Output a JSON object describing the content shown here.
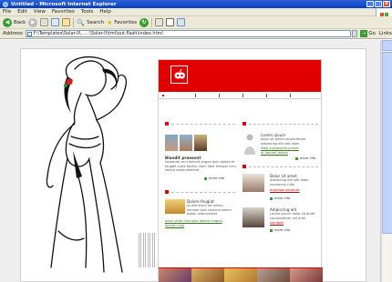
{
  "window": {
    "title": "Untitled - Microsoft Internet Explorer",
    "buttons": [
      "_",
      "□",
      "x"
    ]
  },
  "menu": [
    "File",
    "Edit",
    "View",
    "Favorites",
    "Tools",
    "Help"
  ],
  "toolbar": {
    "back_label": "Back",
    "search_label": "Search",
    "favorites_label": "Favorites"
  },
  "address": {
    "label": "Address",
    "value": "F:\\Templates\\Solar-II\\......\\Solar-II\\tmi\\out.flash\\index.html",
    "go_label": "Go",
    "links_label": "Links"
  },
  "site": {
    "sections": {
      "top_left": {
        "title": "Blandit praesent",
        "body": "luptatum zzril delenit augue duis dolore te feugait nulla facilisi. Nam liber tempor cum soluta nobis eleifend",
        "more": "more info"
      },
      "top_right": {
        "title": "Lorem ipsum",
        "body": "dolor sit amet consectetuer adipiscing elit sed diam",
        "links": [
          "Nibh euismod tincidunt",
          "ut laoreet dolore"
        ],
        "more": "more info"
      },
      "mid_left": {
        "title": "Dolore feugiat",
        "body": "ut wisi enim ad minim veniam quis nostrud exerci tation ullamcorper",
        "links": [
          "dolor vitae duis odio dolore magna",
          "dolore nulla"
        ]
      },
      "mid_right_1": {
        "title": "Dolor sit amet",
        "body": "adipiscing elit sed diam nonummy nibh",
        "links": [
          "euismod tincidunt"
        ],
        "more": "more info"
      },
      "mid_right_2": {
        "title": "Adipiscing elit",
        "body": "Lorem ipsum dolor sit amet consectetuer vel eum",
        "links": [
          "volutpat"
        ],
        "more": "more info"
      }
    }
  },
  "colors": {
    "brand_red": "#e10000",
    "link_green": "#3a7a1f",
    "bullet_green": "#3a9d2f"
  }
}
